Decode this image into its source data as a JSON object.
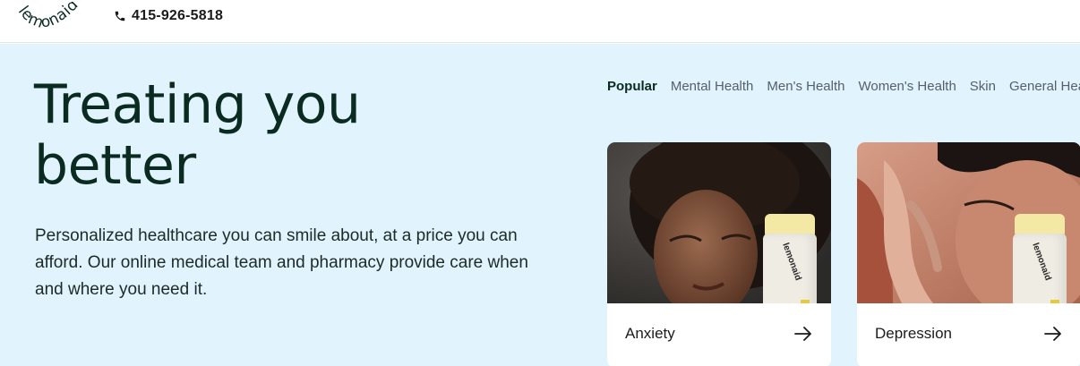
{
  "header": {
    "logo_text": "lemonaid",
    "phone": "415-926-5818"
  },
  "hero": {
    "headline_line1": "Treating you",
    "headline_line2": "better",
    "subtext": "Personalized healthcare you can smile about, at a price you can afford. Our online medical team and pharmacy provide care when and where you need it."
  },
  "tabs": [
    {
      "label": "Popular",
      "active": true
    },
    {
      "label": "Mental Health",
      "active": false
    },
    {
      "label": "Men's Health",
      "active": false
    },
    {
      "label": "Women's Health",
      "active": false
    },
    {
      "label": "Skin",
      "active": false
    },
    {
      "label": "General Health",
      "active": false
    }
  ],
  "cards": [
    {
      "label": "Anxiety",
      "bottle_text": "lemonaid"
    },
    {
      "label": "Depression",
      "bottle_text": "lemonaid"
    }
  ],
  "colors": {
    "hero_bg": "#e1f3fd",
    "headline": "#0b2b21",
    "cap": "#f3e9a4"
  },
  "icons": {
    "phone": "phone-icon",
    "arrow": "arrow-right-icon"
  }
}
